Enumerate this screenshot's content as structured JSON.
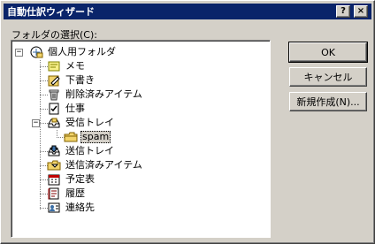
{
  "window": {
    "title": "自動仕訳ウィザード"
  },
  "titlebar_buttons": {
    "help": "?",
    "close": "×"
  },
  "folder_select_label": "フォルダの選択(C):",
  "tree": {
    "root": {
      "label": "個人用フォルダ",
      "icon": "personal-folders-icon",
      "expander": "−"
    },
    "items": [
      {
        "label": "メモ",
        "icon": "notes-icon"
      },
      {
        "label": "下書き",
        "icon": "drafts-icon"
      },
      {
        "label": "削除済みアイテム",
        "icon": "deleted-items-icon"
      },
      {
        "label": "仕事",
        "icon": "tasks-icon"
      },
      {
        "label": "受信トレイ",
        "icon": "inbox-icon",
        "expander": "−"
      },
      {
        "label": "spam",
        "icon": "folder-icon",
        "selected": true
      },
      {
        "label": "送信トレイ",
        "icon": "outbox-icon"
      },
      {
        "label": "送信済みアイテム",
        "icon": "sent-items-icon"
      },
      {
        "label": "予定表",
        "icon": "calendar-icon"
      },
      {
        "label": "履歴",
        "icon": "journal-icon"
      },
      {
        "label": "連絡先",
        "icon": "contacts-icon"
      }
    ]
  },
  "buttons": {
    "ok": "OK",
    "cancel": "キャンセル",
    "new_folder": "新規作成(N)..."
  },
  "colors": {
    "titlebar": "#0a246a",
    "face": "#d4d0c8"
  }
}
